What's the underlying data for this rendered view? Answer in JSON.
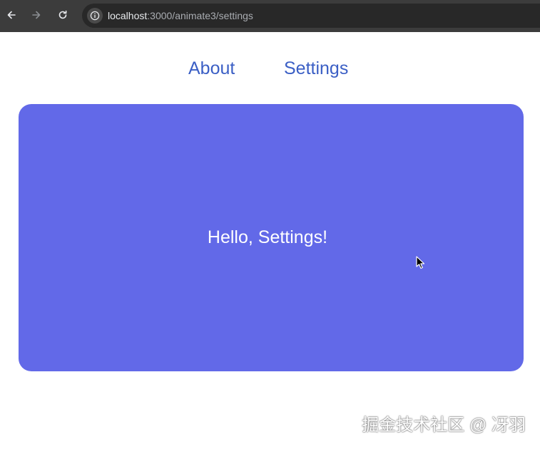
{
  "browser": {
    "url_host": "localhost",
    "url_path": ":3000/animate3/settings",
    "icons": {
      "back": "arrow-left-icon",
      "forward": "arrow-right-icon",
      "reload": "reload-icon",
      "site_info": "info-icon"
    }
  },
  "nav": {
    "about": "About",
    "settings": "Settings"
  },
  "panel": {
    "message": "Hello, Settings!",
    "color": "#6269e8"
  },
  "watermark": "掘金技术社区 @ 冴羽",
  "colors": {
    "link": "#3b5fc5",
    "browser_bar": "#3c3c3c"
  }
}
